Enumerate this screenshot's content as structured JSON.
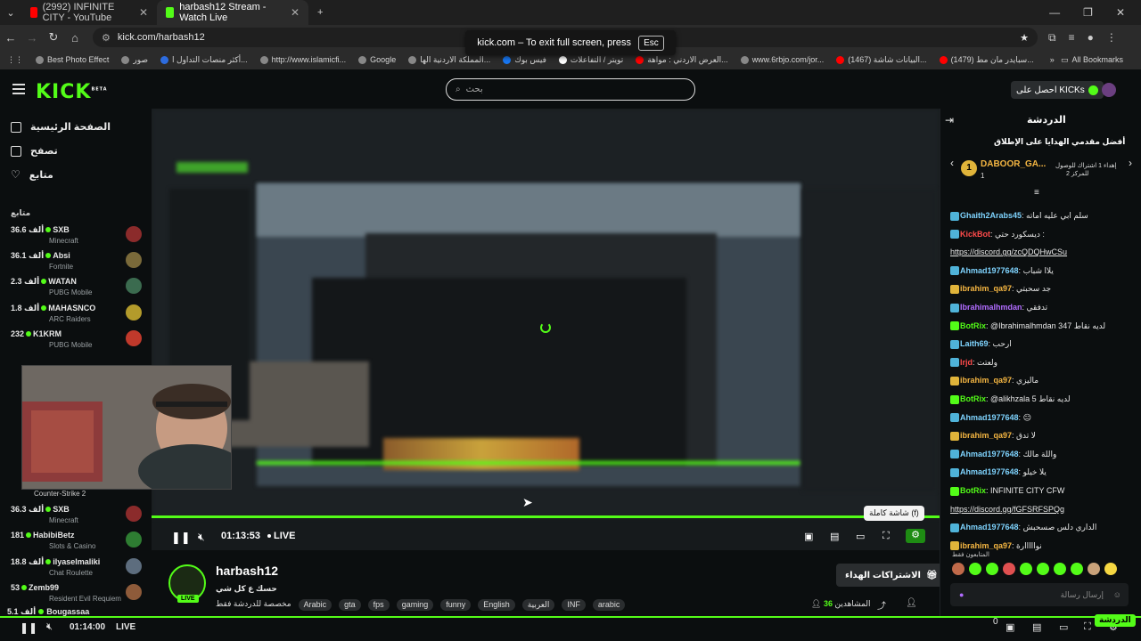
{
  "browser": {
    "tabs": [
      {
        "title": "(2992) INFINITE CITY - YouTube",
        "favicon_color": "#ff0000",
        "active": false
      },
      {
        "title": "harbash12 Stream - Watch Live",
        "favicon_color": "#53fc18",
        "active": true
      }
    ],
    "new_tab": "+",
    "url": "kick.com/harbash12",
    "fullscreen_notice": "kick.com – To exit full screen, press",
    "fullscreen_key": "Esc",
    "bookmarks": [
      {
        "label": "Best Photo Effect",
        "color": "#888888"
      },
      {
        "label": "صور",
        "color": "#888888"
      },
      {
        "label": "أكثر منصات التداول ا...",
        "color": "#2d6cdf"
      },
      {
        "label": "http://www.islamicfi...",
        "color": "#888888"
      },
      {
        "label": "Google",
        "color": "#888888"
      },
      {
        "label": "المملكة الاردنية الها...",
        "color": "#888888"
      },
      {
        "label": "فيس بوك",
        "color": "#1877f2"
      },
      {
        "label": "تويتر / التفاعلات",
        "color": "#ffffff"
      },
      {
        "label": "العرض الاردني : مواهة...",
        "color": "#ff0000"
      },
      {
        "label": "www.6rbjo.com/jor...",
        "color": "#888888"
      },
      {
        "label": "(1467) البيانات شاشة...",
        "color": "#ff0000"
      },
      {
        "label": "(1479) سبايدر مان مط...",
        "color": "#ff0000"
      }
    ],
    "all_bookmarks": "All Bookmarks"
  },
  "kick": {
    "logo": "KICK",
    "logo_sup": "BETA",
    "search_placeholder": "بحث",
    "get_kicks": "احصل على KICKs",
    "nav": [
      {
        "label": "الصفحة الرئيسية",
        "icon": "home-icon"
      },
      {
        "label": "تصفح",
        "icon": "browse-icon"
      },
      {
        "label": "متابع",
        "icon": "heart-icon"
      }
    ],
    "following_header": "متابع",
    "channels": [
      {
        "viewers": "36.6 ألف",
        "name": "SXB",
        "category": "Minecraft",
        "avatar_color": "#8b2b2b"
      },
      {
        "viewers": "36.1 ألف",
        "name": "Absi",
        "category": "Fortnite",
        "avatar_color": "#7a6a3a"
      },
      {
        "viewers": "2.3 ألف",
        "name": "WATAN",
        "category": "PUBG Mobile",
        "avatar_color": "#3b6b4f"
      },
      {
        "viewers": "1.8 ألف",
        "name": "MAHASNCO",
        "category": "ARC Raiders",
        "avatar_color": "#b39b2b"
      },
      {
        "viewers": "232",
        "name": "K1KRM",
        "category": "PUBG Mobile",
        "avatar_color": "#c0392b"
      }
    ],
    "channels_more": [
      {
        "viewers": "36.3 ألف",
        "name": "SXB",
        "category": "Minecraft",
        "avatar_color": "#8b2b2b"
      },
      {
        "viewers": "181",
        "name": "HabibiBetz",
        "category": "Slots & Casino",
        "avatar_color": "#2e7d32"
      },
      {
        "viewers": "18.8 ألف",
        "name": "ilyaselmaliki",
        "category": "Chat Roulette",
        "avatar_color": "#5d6d7e"
      },
      {
        "viewers": "53",
        "name": "Zemb99",
        "category": "Resident Evil Requiem",
        "avatar_color": "#8e5b3a"
      },
      {
        "viewers": "5.1 ألف",
        "name": "Bougassaa",
        "category": "",
        "avatar_color": "#6d4c41"
      }
    ],
    "webcam_category": "Counter-Strike 2",
    "player": {
      "time": "01:13:53",
      "live": "LIVE",
      "tooltip": "شاشة كاملة (f)"
    },
    "stream": {
      "name": "harbash12",
      "title": "حسك ع كل شي",
      "language_label": "مخصصة للدردشة فقط",
      "tags": [
        "Arabic",
        "gta",
        "fps",
        "gaming",
        "funny",
        "English",
        "العربية",
        "INF",
        "arabic"
      ],
      "viewers": "36",
      "viewers_label": "المشاهدين",
      "subscribe": "الاشتراكات الهداء"
    },
    "chat": {
      "title": "الدردشة",
      "gift_header": "أفضل مقدمي الهدايا على الإطلاق",
      "top_gifter": "DABOOR_GA...",
      "top_gifter_rank": "1",
      "top_gifter_count": "1",
      "top_gifter_note": "إهداء 1 اشتراك للوصول",
      "top_gifter_note2": "للمركز 2",
      "messages": [
        {
          "user": "Ghaith2Arabs45",
          "color": "#7fd4ff",
          "text": "سلم ابي عليه اماته"
        },
        {
          "user": "KickBot",
          "color": "#ff4b4b",
          "text": "ديسكورد حتي :"
        },
        {
          "user": "",
          "color": "#7fd4ff",
          "text": "https://discord.gg/zcQDQHwCSu"
        },
        {
          "user": "Ahmad1977648",
          "color": "#7fd4ff",
          "text": "يلاا شباب"
        },
        {
          "user": "ibrahim_qa97",
          "color": "#f5b642",
          "text": "جد سحبتي"
        },
        {
          "user": "Ibrahimalhmdan",
          "color": "#b16cff",
          "text": "تدفقي"
        },
        {
          "user": "BotRix",
          "color": "#53fc18",
          "text": "@Ibrahimalhmdan 347 لديه نقاط"
        },
        {
          "user": "Laith69",
          "color": "#7fd4ff",
          "text": "ارحب"
        },
        {
          "user": "lrjd",
          "color": "#ff4b4b",
          "text": "ولعتت"
        },
        {
          "user": "ibrahim_qa97",
          "color": "#f5b642",
          "text": "ماليزي"
        },
        {
          "user": "BotRix",
          "color": "#53fc18",
          "text": "@alikhzala 5 لديه نقاط"
        },
        {
          "user": "Ahmad1977648",
          "color": "#7fd4ff",
          "text": "😑"
        },
        {
          "user": "ibrahim_qa97",
          "color": "#f5b642",
          "text": "لا تدق"
        },
        {
          "user": "Ahmad1977648",
          "color": "#7fd4ff",
          "text": "واللة مالك"
        },
        {
          "user": "Ahmad1977648",
          "color": "#7fd4ff",
          "text": "يلا خيلو"
        },
        {
          "user": "BotRix",
          "color": "#53fc18",
          "text": "INFINITE CITY CFW"
        },
        {
          "user": "",
          "color": "#7fd4ff",
          "text": "https://discord.gg/fGFSRFSPQg"
        },
        {
          "user": "Ahmad1977648",
          "color": "#7fd4ff",
          "text": "الداري دلس صسحبش"
        },
        {
          "user": "ibrahim_qa97",
          "color": "#f5b642",
          "text": "نوااااارة"
        }
      ],
      "followers_only": "المتابعون فقط",
      "input_placeholder": "إرسال رسالة"
    },
    "bottom_player": {
      "time": "01:14:00",
      "live": "LIVE",
      "viewer_count": "0",
      "chat_button": "الدردشة",
      "channel": "Bougassaa"
    }
  },
  "colors": {
    "kick_green": "#53fc18",
    "bg": "#0b0e0f"
  }
}
